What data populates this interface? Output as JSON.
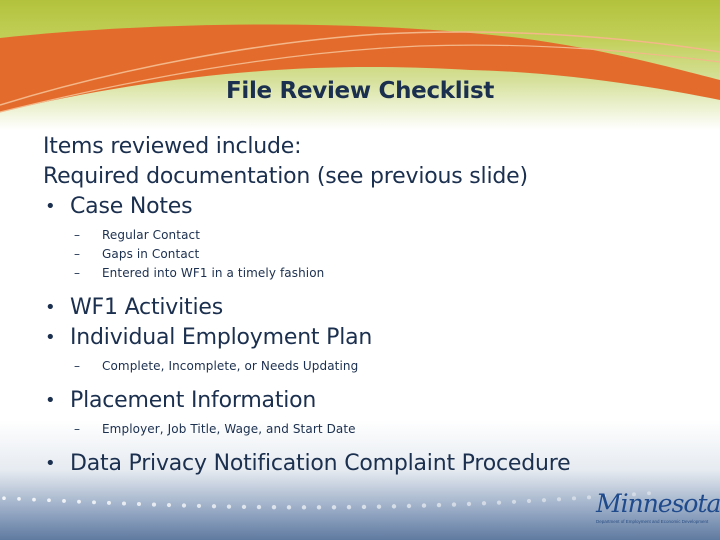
{
  "slide": {
    "title": "File Review Checklist",
    "intro_lines": [
      "Items reviewed include:",
      "Required documentation (see previous slide)"
    ],
    "bullet_glyph": "•",
    "dash_glyph": "–",
    "items": [
      {
        "label": "Case Notes",
        "subitems": [
          "Regular Contact",
          "Gaps in Contact",
          "Entered into WF1 in a timely fashion"
        ]
      },
      {
        "label": "WF1 Activities",
        "subitems": []
      },
      {
        "label": "Individual Employment Plan",
        "subitems": [
          "Complete, Incomplete, or Needs Updating"
        ]
      },
      {
        "label": "Placement Information",
        "subitems": [
          "Employer, Job Title, Wage, and Start Date"
        ]
      },
      {
        "label": "Data Privacy Notification Complaint Procedure",
        "subitems": []
      }
    ]
  },
  "logo": {
    "wordmark": "Minnesota",
    "tagline": "Department of Employment and Economic Development"
  },
  "colors": {
    "title_text": "#1b2f4e",
    "body_text": "#1b2f4e",
    "banner_green": "#b3c23c",
    "banner_orange": "#e36c2d",
    "footer_blue": "#5f7aa0",
    "logo_blue": "#1f4a8c"
  }
}
